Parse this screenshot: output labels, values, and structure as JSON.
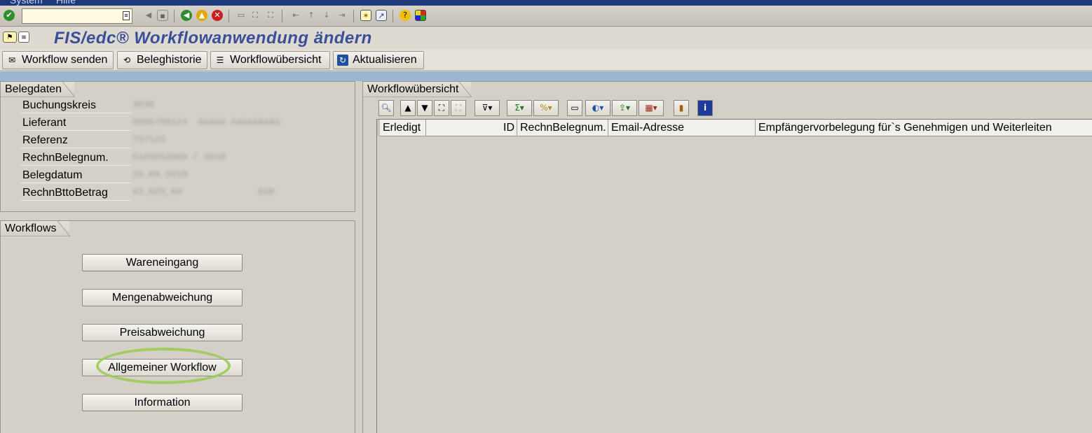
{
  "menubar": {
    "items": [
      "System",
      "Hilfe"
    ]
  },
  "systoolbar": {
    "command_field_value": "",
    "icons": [
      "enter-icon",
      "back-icon",
      "exit-icon",
      "cancel-icon",
      "print-icon",
      "find-icon",
      "find-next-icon",
      "first-page-icon",
      "previous-page-icon",
      "next-page-icon",
      "last-page-icon",
      "create-session-icon",
      "shortcut-icon",
      "help-icon",
      "customize-layout-icon"
    ]
  },
  "title": {
    "text": "FIS/edc® Workflowanwendung ändern"
  },
  "app_toolbar": {
    "buttons": [
      {
        "label": "Workflow senden",
        "icon": "send-icon"
      },
      {
        "label": "Beleghistorie",
        "icon": "history-icon"
      },
      {
        "label": "Workflowübersicht",
        "icon": "overview-icon"
      },
      {
        "label": "Aktualisieren",
        "icon": "refresh-icon"
      }
    ]
  },
  "belegdaten": {
    "title": "Belegdaten",
    "fields": [
      {
        "label": "Buchungskreis",
        "value": "3030"
      },
      {
        "label": "Lieferant",
        "value": "0000709124  AAAAA AAAAAAAAA"
      },
      {
        "label": "Referenz",
        "value": "737122"
      },
      {
        "label": "RechnBelegnum.",
        "value": "5103252089 / 2019"
      },
      {
        "label": "Belegdatum",
        "value": "25.09.2019"
      },
      {
        "label": "RechnBttoBetrag",
        "value": "43.025,09              EUR"
      }
    ]
  },
  "workflows": {
    "title": "Workflows",
    "buttons": [
      "Wareneingang",
      "Mengenabweichung",
      "Preisabweichung",
      "Allgemeiner Workflow",
      "Information"
    ]
  },
  "overview": {
    "title": "Workflowübersicht",
    "toolbar_icons": [
      "details-icon",
      "sort-ascending-icon",
      "sort-descending-icon",
      "find-icon",
      "find-next-icon",
      "filter-icon",
      "sum-icon",
      "subtotal-icon",
      "print-icon",
      "views-icon",
      "export-icon",
      "layout-icon",
      "graphic-icon",
      "info-icon"
    ],
    "columns": [
      "Erledigt",
      "ID",
      "RechnBelegnum.",
      "Email-Adresse",
      "Empfängervorbelegung für`s Genehmigen und Weiterleiten"
    ],
    "rows": []
  }
}
